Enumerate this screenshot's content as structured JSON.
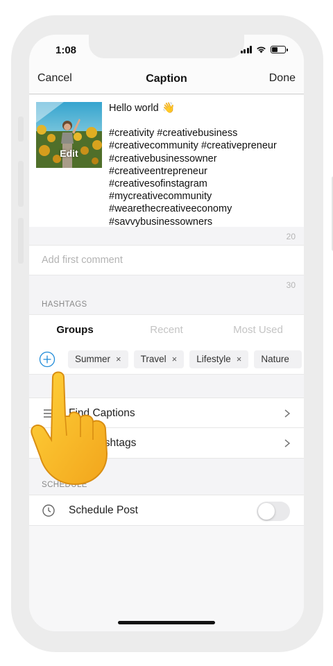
{
  "status_bar": {
    "time": "1:08"
  },
  "nav": {
    "cancel_label": "Cancel",
    "title": "Caption",
    "done_label": "Done"
  },
  "caption": {
    "thumbnail_edit_label": "Edit",
    "first_line": "Hello world",
    "emoji": "👋",
    "hashtag_lines": [
      "#creativity #creativebusiness",
      "#creativecommunity #creativepreneur",
      "#creativebusinessowner",
      "#creativeentrepreneur",
      "#creativesofinstagram",
      "#mycreativecommunity",
      "#wearethecreativeeconomy",
      "#savvybusinessowners"
    ],
    "caption_counter": "20"
  },
  "comment": {
    "placeholder": "Add first comment",
    "value": "",
    "comment_counter": "30"
  },
  "hashtags": {
    "section_label": "HASHTAGS",
    "tabs": [
      {
        "label": "Groups",
        "active": true
      },
      {
        "label": "Recent",
        "active": false
      },
      {
        "label": "Most Used",
        "active": false
      }
    ],
    "chips": [
      {
        "label": "Summer",
        "remove": "×"
      },
      {
        "label": "Travel",
        "remove": "×"
      },
      {
        "label": "Lifestyle",
        "remove": "×"
      },
      {
        "label": "Nature",
        "remove": ""
      }
    ]
  },
  "tools": {
    "find_captions_label": "Find Captions",
    "add_hashtags_label": "Add Hashtags"
  },
  "schedule": {
    "section_label": "SCHEDULE",
    "schedule_post_label": "Schedule Post",
    "enabled": false
  },
  "colors": {
    "accent": "#1f8bd8",
    "toggle_off": "#e9e9eb"
  },
  "icons": {
    "plus": "plus-circle-icon",
    "list": "list-icon",
    "add": "plus-icon",
    "clock": "clock-icon",
    "chevron": "chevron-right-icon",
    "hand": "pointing-hand-icon"
  }
}
